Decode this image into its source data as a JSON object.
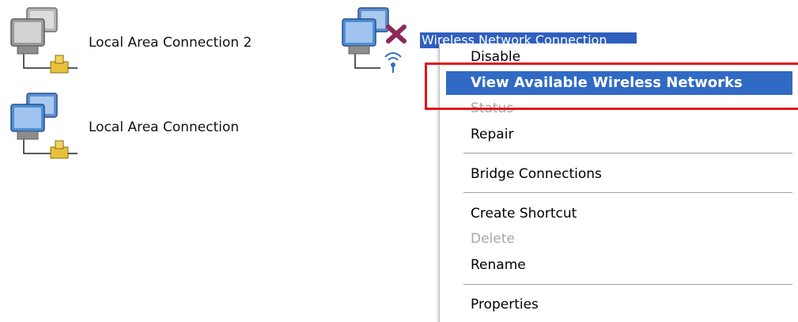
{
  "connections": [
    {
      "label": "Local Area Connection 2",
      "icon": "lan-connection-icon",
      "state": "normal"
    },
    {
      "label": "Local Area Connection",
      "icon": "lan-connection-icon",
      "state": "normal"
    },
    {
      "label": "Wireless Network Connection",
      "icon": "wireless-connection-icon",
      "state": "disconnected-selected"
    }
  ],
  "context_menu": {
    "items": [
      {
        "label": "Disable",
        "state": "normal"
      },
      {
        "label": "View Available Wireless Networks",
        "state": "highlighted-bold"
      },
      {
        "label": "Status",
        "state": "disabled"
      },
      {
        "label": "Repair",
        "state": "normal"
      },
      {
        "label": "Bridge Connections",
        "state": "normal"
      },
      {
        "label": "Create Shortcut",
        "state": "normal"
      },
      {
        "label": "Delete",
        "state": "disabled"
      },
      {
        "label": "Rename",
        "state": "normal"
      },
      {
        "label": "Properties",
        "state": "normal"
      }
    ]
  },
  "colors": {
    "highlight": "#316ac5",
    "selection": "#2f5fbf",
    "annotation": "#e0161d",
    "disabled_text": "#a7a7a7",
    "monitor_blue": "#4d8ed6",
    "monitor_gray": "#9a9a9a",
    "plug_yellow": "#e8c13c",
    "disconnect_x": "#8a2b5a"
  }
}
